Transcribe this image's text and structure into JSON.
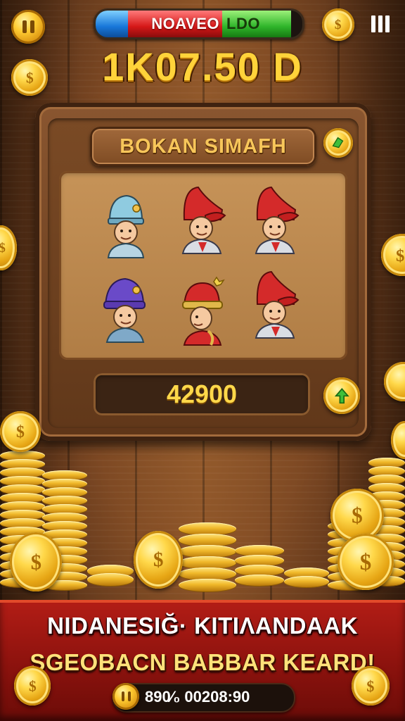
{
  "hud": {
    "left_icon": "pause-icon",
    "energy_bar": {
      "label_red": "NOAVEO",
      "label_green": "LDO",
      "colors": {
        "blue": "#1877d9",
        "red": "#d61818",
        "green": "#2fb52a"
      }
    },
    "right_icon": "menu-icon",
    "score": "1K07.50 D"
  },
  "board": {
    "title": "BOKAN SIMAFH",
    "corner_icon": "leaf-gem-icon",
    "characters": [
      {
        "name": "blue-hat-character",
        "hat_color": "#8fcbe0"
      },
      {
        "name": "red-hat-character",
        "hat_color": "#d42a2a"
      },
      {
        "name": "red-hat-character",
        "hat_color": "#d42a2a"
      },
      {
        "name": "purple-hat-character",
        "hat_color": "#6a4ac8"
      },
      {
        "name": "red-beanie-character",
        "hat_color": "#d42a2a"
      },
      {
        "name": "red-hat-character",
        "hat_color": "#d42a2a"
      }
    ],
    "amount": "42900",
    "action_icon": "green-arrow-icon"
  },
  "banner": {
    "line1": "NIDANESIĞ· KITIΛANDAAK",
    "line2": "SGEOBACN BABBAR KEARD!",
    "footer_value": "890⁄₀ 00208:90",
    "footer_icon": "coin-pause-icon"
  },
  "colors": {
    "gold": "#ffd33a",
    "wood_dark": "#4a2812",
    "banner_red": "#b31d16"
  }
}
